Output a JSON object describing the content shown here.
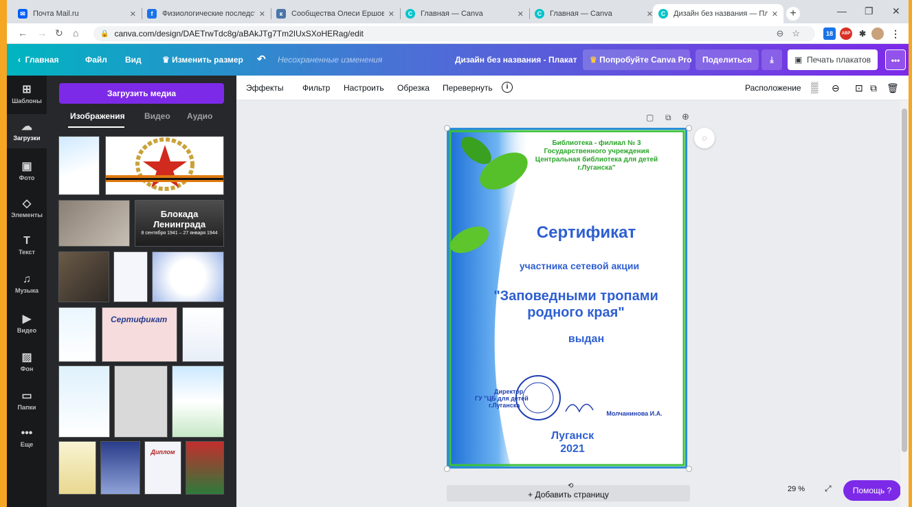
{
  "browser": {
    "tabs": [
      {
        "title": "Почта Mail.ru",
        "favicon": "mail-icon",
        "color": "#005ff9"
      },
      {
        "title": "Физиологические последст",
        "favicon": "f-icon",
        "color": "#1a73e8"
      },
      {
        "title": "Сообщества Олеси Ершово",
        "favicon": "vk-icon",
        "color": "#4a76a8"
      },
      {
        "title": "Главная — Canva",
        "favicon": "canva-icon",
        "color": "#00c4cc"
      },
      {
        "title": "Главная — Canva",
        "favicon": "canva-icon",
        "color": "#00c4cc"
      },
      {
        "title": "Дизайн без названия — Пл",
        "favicon": "canva-icon",
        "color": "#00c4cc"
      }
    ],
    "url": "canva.com/design/DAETrwTdc8g/aBAkJTg7Tm2IUxSXoHERag/edit",
    "extension_badge": "18",
    "abp_label": "ABP"
  },
  "header": {
    "back": "Главная",
    "file": "Файл",
    "view": "Вид",
    "resize": "Изменить размер",
    "unsaved": "Несохраненные изменения",
    "design_title": "Дизайн без названия - Плакат",
    "try_pro": "Попробуйте Canva Pro",
    "share": "Поделиться",
    "print": "Печать плакатов",
    "more": "•••"
  },
  "rail": [
    {
      "label": "Шаблоны",
      "icon": "templates-icon",
      "glyph": "⊞"
    },
    {
      "label": "Загрузки",
      "icon": "upload-icon",
      "glyph": "☁"
    },
    {
      "label": "Фото",
      "icon": "photo-icon",
      "glyph": "▣"
    },
    {
      "label": "Элементы",
      "icon": "elements-icon",
      "glyph": "◇"
    },
    {
      "label": "Текст",
      "icon": "text-icon",
      "glyph": "T"
    },
    {
      "label": "Музыка",
      "icon": "music-icon",
      "glyph": "♫"
    },
    {
      "label": "Видео",
      "icon": "video-icon",
      "glyph": "▶"
    },
    {
      "label": "Фон",
      "icon": "background-icon",
      "glyph": "▨"
    },
    {
      "label": "Папки",
      "icon": "folder-icon",
      "glyph": "▭"
    },
    {
      "label": "Еще",
      "icon": "more-icon",
      "glyph": "•••"
    }
  ],
  "panel": {
    "upload_button": "Загрузить медиа",
    "tabs": [
      "Изображения",
      "Видео",
      "Аудио"
    ],
    "blockade_title": "Блокада Ленинграда",
    "blockade_dates": "8 сентября 1941 – 27 января 1944",
    "thumb_cert": "Сертификат",
    "thumb_diploma": "Диплом"
  },
  "toolbar": {
    "effects": "Эффекты",
    "filter": "Фильтр",
    "adjust": "Настроить",
    "crop": "Обрезка",
    "flip": "Перевернуть",
    "info": "i",
    "position": "Расположение"
  },
  "certificate": {
    "org_line1": "Библиотека - филиал № 3",
    "org_line2": "Государственного учреждения",
    "org_line3": "Центральная библиотека для детей",
    "org_line4": "г.Луганска\"",
    "title": "Сертификат",
    "subtitle": "участника сетевой акции",
    "action_line1": "\"Заповедными тропами",
    "action_line2": "родного края\"",
    "issued": "выдан",
    "director_line1": "Директор",
    "director_line2": "ГУ \"ЦБ для детей",
    "director_line3": "г.Луганска",
    "signer": "Молчанинова И.А.",
    "city": "Луганск",
    "year": "2021",
    "stamp_text": "«ЦЕНТРАЛЬНАЯ БИБЛИОТЕКА ДЛЯ ДЕТЕЙ г.ЛУГАНСКА»"
  },
  "canvas": {
    "add_page": "+ Добавить страницу",
    "zoom": "29 %",
    "help": "Помощь ?"
  },
  "colors": {
    "accent": "#7d2ae8",
    "cert_blue": "#2e5fd1",
    "cert_green": "#1db31d"
  }
}
